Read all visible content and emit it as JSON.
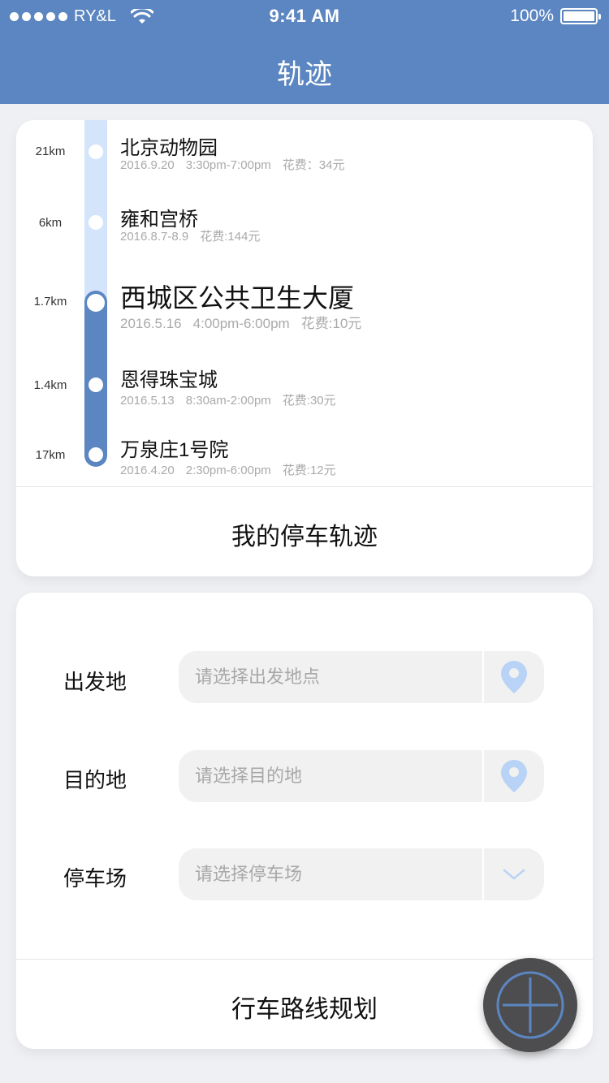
{
  "status_bar": {
    "carrier": "RY&L",
    "time": "9:41 AM",
    "battery": "100%"
  },
  "header": {
    "title": "轨迹"
  },
  "track": {
    "items": [
      {
        "distance": "21km",
        "place": "北京动物园",
        "date": "2016.9.20",
        "time": "3:30pm-7:00pm",
        "cost": "花费：34元"
      },
      {
        "distance": "6km",
        "place": "雍和宫桥",
        "date": "2016.8.7-8.9",
        "time": "",
        "cost": "花费:144元"
      },
      {
        "distance": "1.7km",
        "place": "西城区公共卫生大厦",
        "date": "2016.5.16",
        "time": "4:00pm-6:00pm",
        "cost": "花费:10元"
      },
      {
        "distance": "1.4km",
        "place": "恩得珠宝城",
        "date": "2016.5.13",
        "time": "8:30am-2:00pm",
        "cost": "花费:30元"
      },
      {
        "distance": "17km",
        "place": "万泉庄1号院",
        "date": "2016.4.20",
        "time": "2:30pm-6:00pm",
        "cost": "花费:12元"
      }
    ],
    "footer_label": "我的停车轨迹"
  },
  "planner": {
    "origin": {
      "label": "出发地",
      "placeholder": "请选择出发地点"
    },
    "destination": {
      "label": "目的地",
      "placeholder": "请选择目的地"
    },
    "parking": {
      "label": "停车场",
      "placeholder": "请选择停车场"
    },
    "footer_label": "行车路线规划"
  },
  "colors": {
    "header": "#5b86c1",
    "track_light": "#d4e4fb",
    "pin_icon": "#b8d3f5",
    "fab": "#4d4d4f",
    "fab_ring": "#5b86c1"
  },
  "icons": {
    "signal": "signal-dots-icon",
    "wifi": "wifi-icon",
    "battery": "battery-icon",
    "location": "location-pin-icon",
    "dropdown": "chevron-down-icon",
    "add": "plus-icon"
  }
}
